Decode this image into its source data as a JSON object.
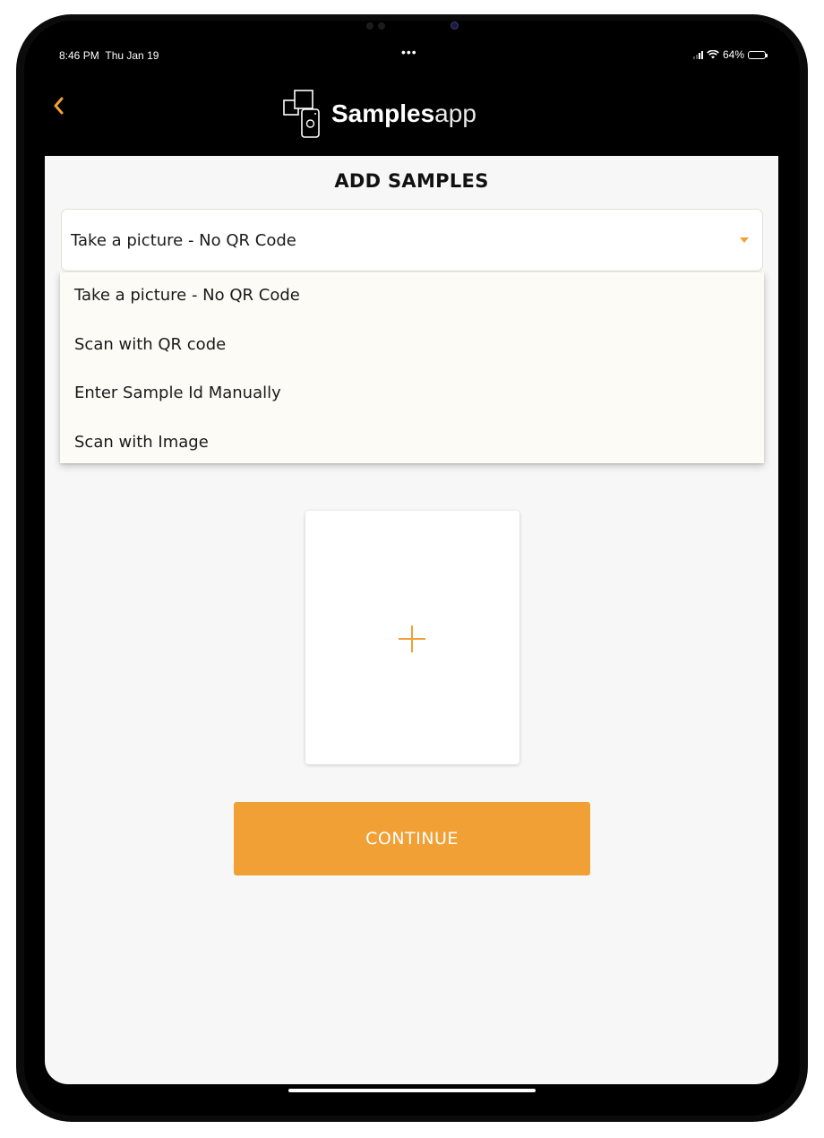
{
  "status_bar": {
    "time": "8:46 PM",
    "date": "Thu Jan 19",
    "center_dots": "•••",
    "battery_percent": "64%"
  },
  "navbar": {
    "back_icon": "chevron-left-icon",
    "logo_bold": "Samples",
    "logo_light": "app"
  },
  "page": {
    "title": "ADD SAMPLES"
  },
  "sample_type_select": {
    "selected": "Take a picture - No QR Code",
    "options": [
      "Take a picture - No QR Code",
      "Scan with QR code",
      "Enter Sample Id Manually",
      "Scan with Image"
    ]
  },
  "photo_card": {
    "icon": "plus-icon"
  },
  "continue_button": {
    "label": "CONTINUE"
  },
  "colors": {
    "accent": "#f0a035",
    "header_bg": "#000000",
    "content_bg": "#f7f7f7",
    "dropdown_bg": "#fdfbf6"
  }
}
